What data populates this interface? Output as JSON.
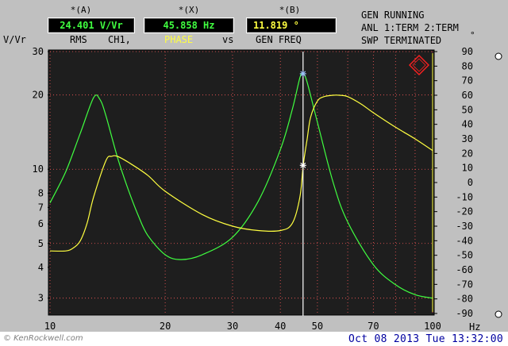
{
  "markers": {
    "a": {
      "label": "*(A)",
      "value": "24.401 V/Vr"
    },
    "x": {
      "label": "*(X)",
      "value": "45.858  Hz"
    },
    "b": {
      "label": "*(B)",
      "value": "11.819 °"
    }
  },
  "subtitles": {
    "rms": "RMS",
    "ch": "CH1,",
    "phase": "PHASE",
    "vs": "vs",
    "genfreq": "GEN FREQ"
  },
  "status": {
    "line1": "GEN RUNNING",
    "line2": "ANL 1:TERM 2:TERM",
    "line3": "SWP TERMINATED"
  },
  "left_unit": "V/Vr",
  "right_unit": "°",
  "x_unit": "Hz",
  "datetime": "Oct 08 2013 Tue 13:32:00",
  "watermark": "© KenRockwell.com",
  "colors": {
    "background": "#c0c0c0",
    "plot_bg": "#1e1e1e",
    "grid": "#ff5a5a",
    "green_trace": "#40ff40",
    "yellow_trace": "#ffff40",
    "readout_a": "#40ff40",
    "readout_x": "#40ff40",
    "readout_b": "#ffff40",
    "phase_label": "#ffff40",
    "marker_line": "#ffffff"
  },
  "chart_data": {
    "type": "line",
    "x_scale": "log",
    "xlim": [
      10,
      100
    ],
    "x_ticks": [
      10,
      20,
      30,
      40,
      50,
      70,
      100
    ],
    "x_tick_labels": [
      "10",
      "20",
      "30",
      "40",
      "50",
      "70",
      "100"
    ],
    "x_grid": [
      10,
      20,
      30,
      40,
      50,
      60,
      70,
      80,
      90,
      100
    ],
    "left_scale": "log",
    "ylim_left": [
      2.6,
      30
    ],
    "left_ticks": [
      3,
      4,
      5,
      6,
      7,
      8,
      10,
      20,
      30
    ],
    "left_tick_labels": [
      "3",
      "4",
      "5",
      "6",
      "7",
      "8",
      "10",
      "20",
      "30"
    ],
    "left_grid": [
      3,
      5,
      10,
      20,
      30
    ],
    "ylim_right": [
      -90,
      90
    ],
    "right_ticks": [
      90,
      80,
      70,
      60,
      50,
      40,
      30,
      20,
      10,
      0,
      -10,
      -20,
      -30,
      -40,
      -50,
      -60,
      -70,
      -80,
      -90
    ],
    "right_tick_labels": [
      "90",
      "80",
      "70",
      "60",
      "50",
      "40",
      "30",
      "20",
      "10",
      "0",
      "-10",
      "-20",
      "-30",
      "-40",
      "-50",
      "-60",
      "-70",
      "-80",
      "-90"
    ],
    "series": [
      {
        "axis": "left",
        "x": [
          10,
          11,
          12,
          13,
          13.5,
          14,
          15,
          16,
          17,
          18,
          20,
          22,
          25,
          30,
          35,
          40,
          43,
          45,
          45.9,
          47,
          50,
          55,
          60,
          70,
          80,
          90,
          100
        ],
        "y": [
          7.3,
          9.8,
          14,
          19.5,
          19.2,
          16.5,
          11.2,
          8.3,
          6.5,
          5.4,
          4.5,
          4.3,
          4.5,
          5.3,
          7.4,
          12,
          17.5,
          23.5,
          24.4,
          22.5,
          15.5,
          8.8,
          6.1,
          4.1,
          3.4,
          3.1,
          3.0
        ]
      },
      {
        "axis": "right",
        "x": [
          10,
          11,
          11.5,
          12,
          12.5,
          13,
          14,
          14.5,
          15,
          16,
          18,
          20,
          25,
          30,
          35,
          40,
          43,
          45,
          45.9,
          47,
          48,
          50,
          52,
          55,
          57,
          60,
          65,
          70,
          80,
          90,
          100
        ],
        "y": [
          -47,
          -47,
          -45,
          -40,
          -28,
          -10,
          15,
          18,
          18,
          14,
          5,
          -6,
          -22,
          -30,
          -33,
          -33,
          -28,
          -10,
          11.8,
          30,
          45,
          56,
          59,
          60,
          60,
          59,
          54,
          48,
          38,
          30,
          22
        ]
      }
    ],
    "marker_x": 45.858,
    "marker_a_value": 24.401,
    "marker_b_value": 11.819
  }
}
